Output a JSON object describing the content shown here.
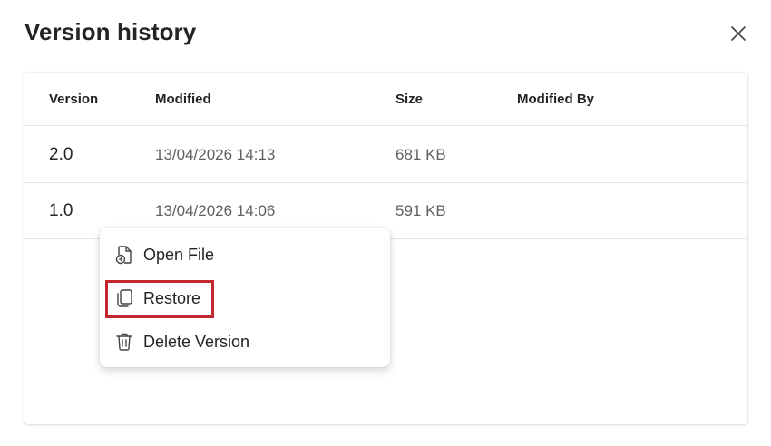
{
  "dialog": {
    "title": "Version history",
    "close_icon": "close-icon"
  },
  "table": {
    "columns": [
      "Version",
      "Modified",
      "Size",
      "Modified By"
    ],
    "rows": [
      {
        "version": "2.0",
        "modified": "13/04/2026 14:13",
        "size": "681 KB",
        "modified_by": ""
      },
      {
        "version": "1.0",
        "modified": "13/04/2026 14:06",
        "size": "591 KB",
        "modified_by": ""
      }
    ]
  },
  "context_menu": {
    "items": [
      {
        "label": "Open File",
        "icon": "open-file-icon"
      },
      {
        "label": "Restore",
        "icon": "restore-icon"
      },
      {
        "label": "Delete Version",
        "icon": "delete-icon"
      }
    ],
    "highlighted_item": "Restore",
    "highlight_color": "#c4262e"
  }
}
